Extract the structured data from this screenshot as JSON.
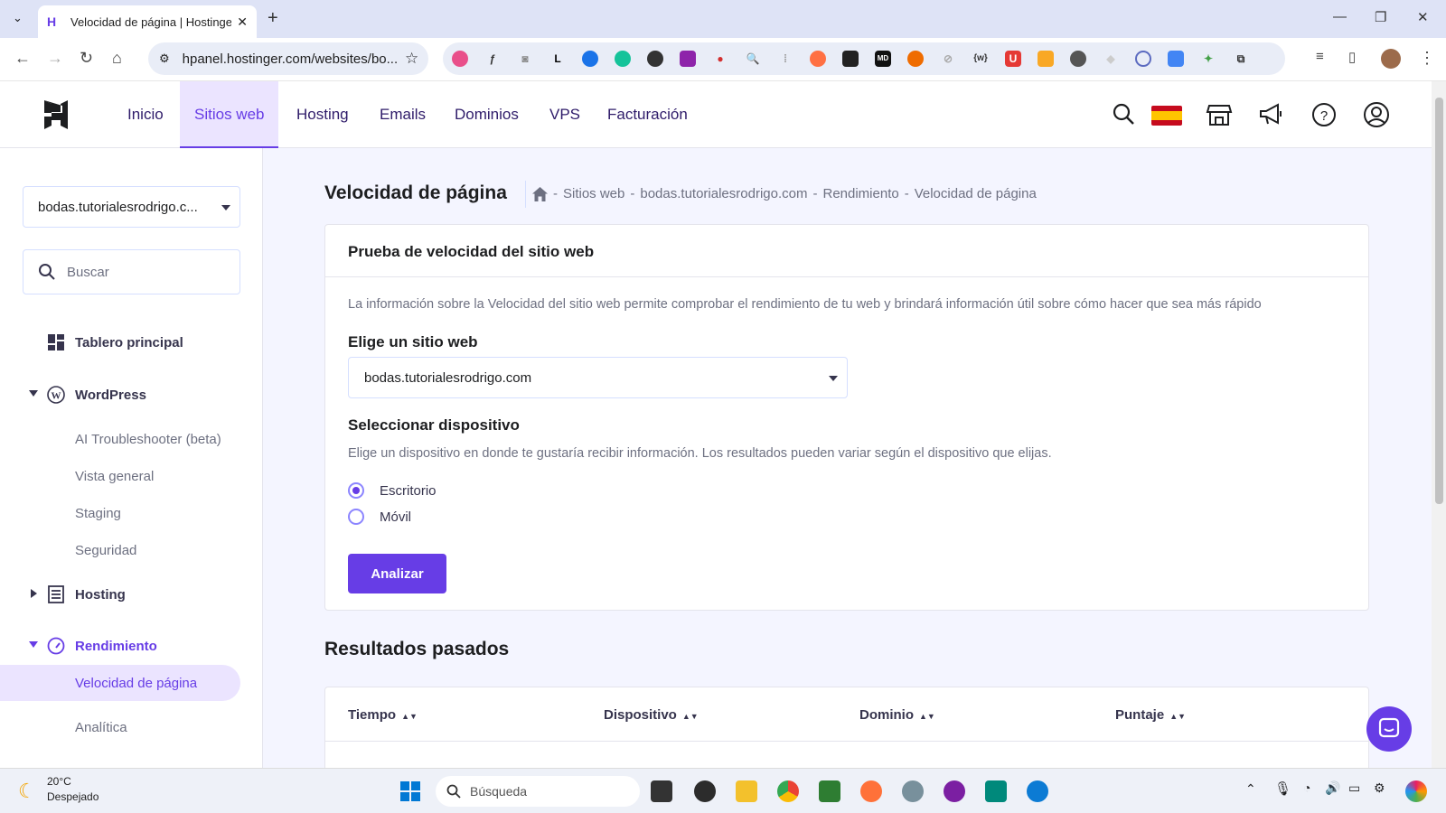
{
  "browser": {
    "tab_title": "Velocidad de página | Hostinger",
    "url": "hpanel.hostinger.com/websites/bo..."
  },
  "header": {
    "nav": [
      "Inicio",
      "Sitios web",
      "Hosting",
      "Emails",
      "Dominios",
      "VPS",
      "Facturación"
    ],
    "active_nav": "Sitios web"
  },
  "sidebar": {
    "site_selector": "bodas.tutorialesrodrigo.c...",
    "search_placeholder": "Buscar",
    "dashboard": "Tablero principal",
    "wordpress": "WordPress",
    "wp_items": [
      "AI Troubleshooter (beta)",
      "Vista general",
      "Staging",
      "Seguridad"
    ],
    "hosting": "Hosting",
    "rendimiento": "Rendimiento",
    "perf_items": [
      "Velocidad de página",
      "Analítica"
    ]
  },
  "main": {
    "title": "Velocidad de página",
    "breadcrumb": [
      "Sitios web",
      "bodas.tutorialesrodrigo.com",
      "Rendimiento",
      "Velocidad de página"
    ],
    "card_title": "Prueba de velocidad del sitio web",
    "description": "La información sobre la Velocidad del sitio web permite comprobar el rendimiento de tu web y brindará información útil sobre cómo hacer que sea más rápido",
    "choose_site_label": "Elige un sitio web",
    "chosen_site": "bodas.tutorialesrodrigo.com",
    "device_label": "Seleccionar dispositivo",
    "device_desc": "Elige un dispositivo en donde te gustaría recibir información. Los resultados pueden variar según el dispositivo que elijas.",
    "devices": [
      "Escritorio",
      "Móvil"
    ],
    "selected_device": "Escritorio",
    "analyze_button": "Analizar",
    "past_results_title": "Resultados pasados",
    "table_headers": [
      "Tiempo",
      "Dispositivo",
      "Dominio",
      "Puntaje"
    ]
  },
  "taskbar": {
    "temp": "20°C",
    "weather": "Despejado",
    "search": "Búsqueda"
  },
  "colors": {
    "accent": "#673de6",
    "active_bg": "#ebe4ff"
  }
}
